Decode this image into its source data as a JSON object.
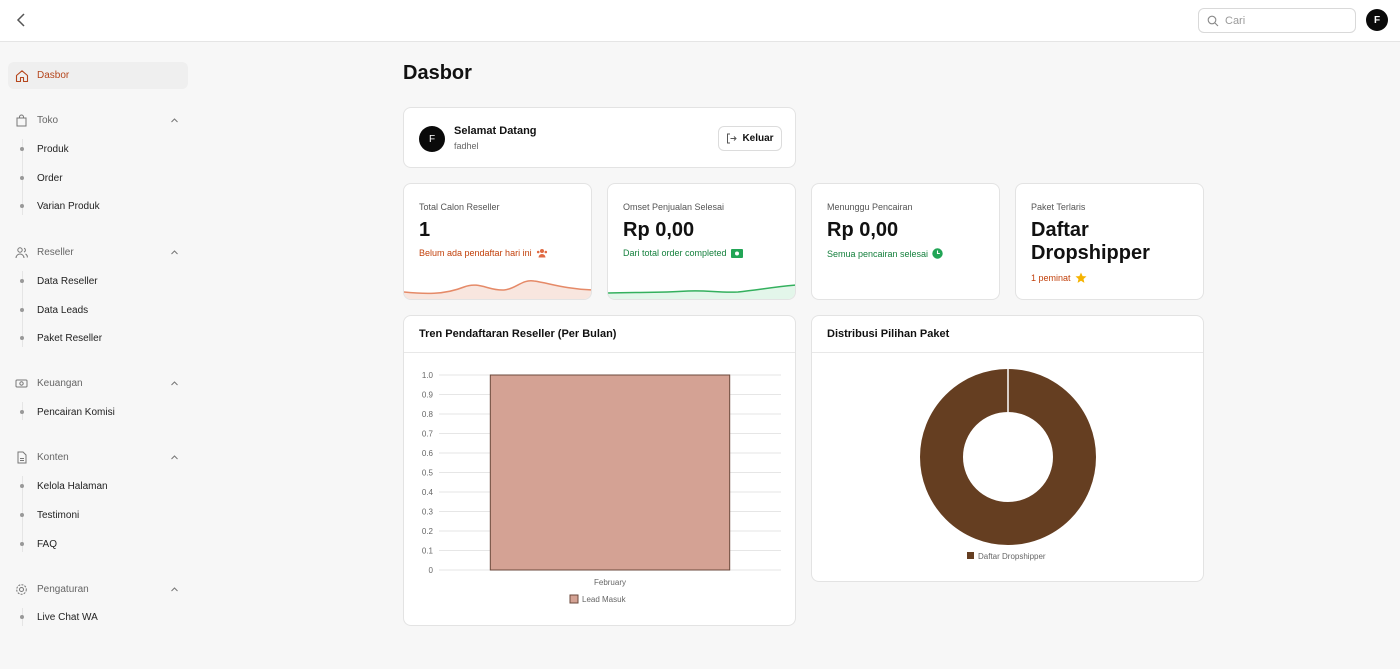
{
  "topbar": {
    "search_placeholder": "Cari",
    "avatar_initial": "F"
  },
  "sidebar": {
    "active": {
      "label": "Dasbor"
    },
    "sections": {
      "toko": {
        "label": "Toko",
        "items": [
          "Produk",
          "Order",
          "Varian Produk"
        ]
      },
      "reseller": {
        "label": "Reseller",
        "items": [
          "Data Reseller",
          "Data Leads",
          "Paket Reseller"
        ]
      },
      "keuangan": {
        "label": "Keuangan",
        "items": [
          "Pencairan Komisi"
        ]
      },
      "konten": {
        "label": "Konten",
        "items": [
          "Kelola Halaman",
          "Testimoni",
          "FAQ"
        ]
      },
      "pengaturan": {
        "label": "Pengaturan",
        "items": [
          "Live Chat WA"
        ]
      }
    }
  },
  "main": {
    "title": "Dasbor",
    "welcome": {
      "avatar_initial": "F",
      "greeting": "Selamat Datang",
      "username": "fadhel",
      "logout_label": "Keluar"
    },
    "stats": [
      {
        "label": "Total Calon Reseller",
        "value": "1",
        "note": "Belum ada pendaftar hari ini",
        "note_color": "#c2410c",
        "icon": "users-icon"
      },
      {
        "label": "Omset Penjualan Selesai",
        "value": "Rp 0,00",
        "note": "Dari total order completed",
        "note_color": "#15803d",
        "icon": "money-icon"
      },
      {
        "label": "Menunggu Pencairan",
        "value": "Rp 0,00",
        "note": "Semua pencairan selesai",
        "note_color": "#15803d",
        "icon": "check-circle-icon"
      },
      {
        "label": "Paket Terlaris",
        "value": "Daftar Dropshipper",
        "note": "1 peminat",
        "note_color": "#c2410c",
        "icon": "star-icon"
      }
    ],
    "trend_panel": {
      "title": "Tren Pendaftaran Reseller (Per Bulan)"
    },
    "dist_panel": {
      "title": "Distribusi Pilihan Paket"
    }
  },
  "colors": {
    "accent": "#b5451b",
    "bar_fill": "#d4a294",
    "bar_stroke": "#6b4a3c",
    "donut": "#653e21"
  },
  "chart_data": [
    {
      "type": "bar",
      "categories": [
        "February"
      ],
      "series": [
        {
          "name": "Lead Masuk",
          "values": [
            1
          ]
        }
      ],
      "yticks": [
        "0",
        "0.1",
        "0.2",
        "0.3",
        "0.4",
        "0.5",
        "0.6",
        "0.7",
        "0.8",
        "0.9",
        "1.0"
      ],
      "ylim": [
        0,
        1
      ],
      "grid": true,
      "legend": "bottom"
    },
    {
      "type": "pie",
      "donut": true,
      "labels": [
        "Daftar Dropshipper"
      ],
      "values": [
        1
      ],
      "legend": "bottom"
    }
  ]
}
